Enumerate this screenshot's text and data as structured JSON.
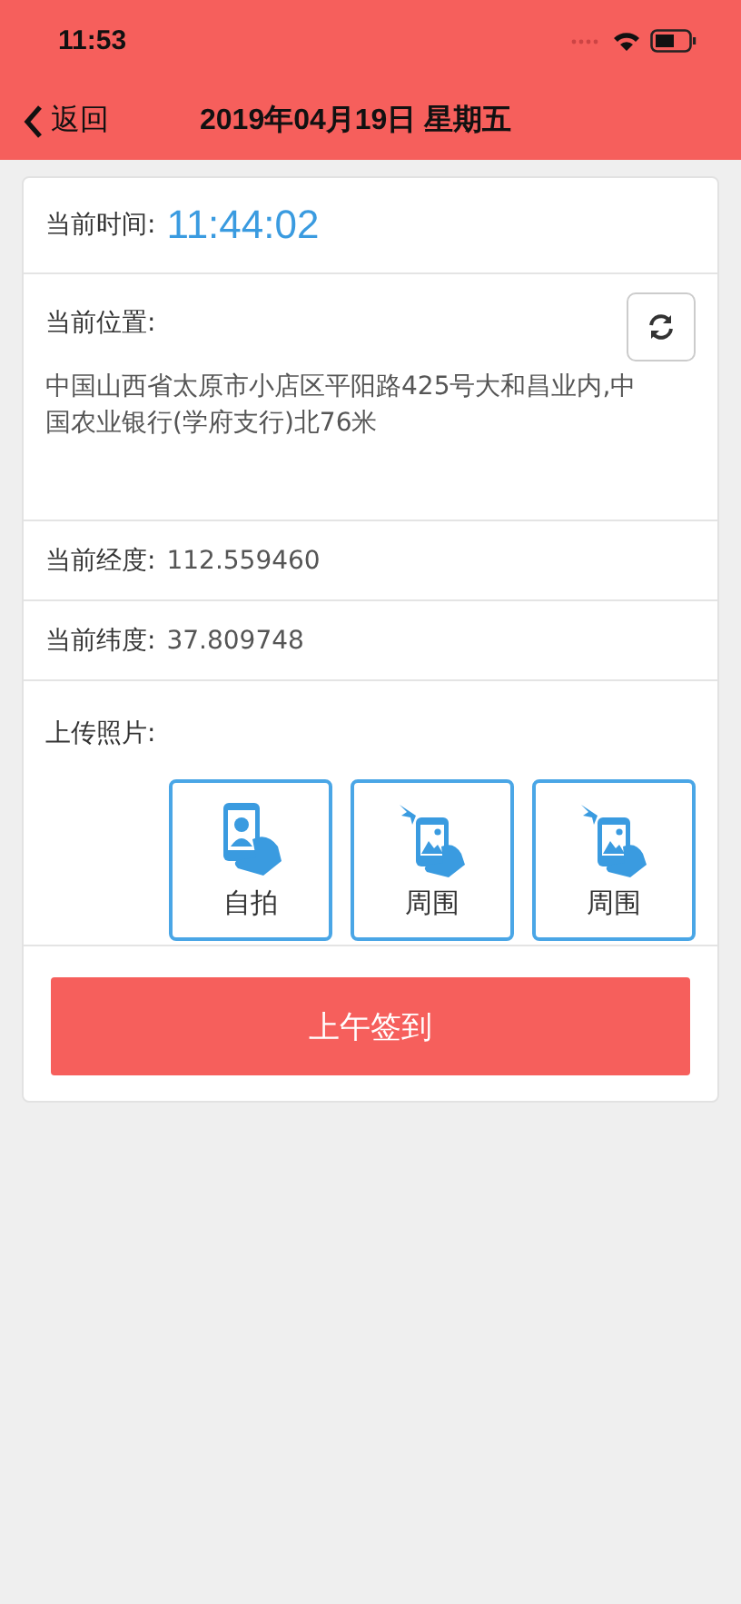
{
  "status_bar": {
    "time": "11:53"
  },
  "nav": {
    "back": "返回",
    "title": "2019年04月19日 星期五"
  },
  "time_row": {
    "label": "当前时间:",
    "value": "11:44:02"
  },
  "location": {
    "label": "当前位置:",
    "address": "中国山西省太原市小店区平阳路425号大和昌业内,中国农业银行(学府支行)北76米"
  },
  "coords": [
    {
      "label": "当前经度:",
      "value": "112.559460"
    },
    {
      "label": "当前纬度:",
      "value": "37.809748"
    }
  ],
  "upload": {
    "label": "上传照片:",
    "photos": [
      {
        "kind": "selfie",
        "label": "自拍"
      },
      {
        "kind": "surroundings",
        "label": "周围"
      },
      {
        "kind": "surroundings",
        "label": "周围"
      }
    ]
  },
  "submit": "上午签到"
}
